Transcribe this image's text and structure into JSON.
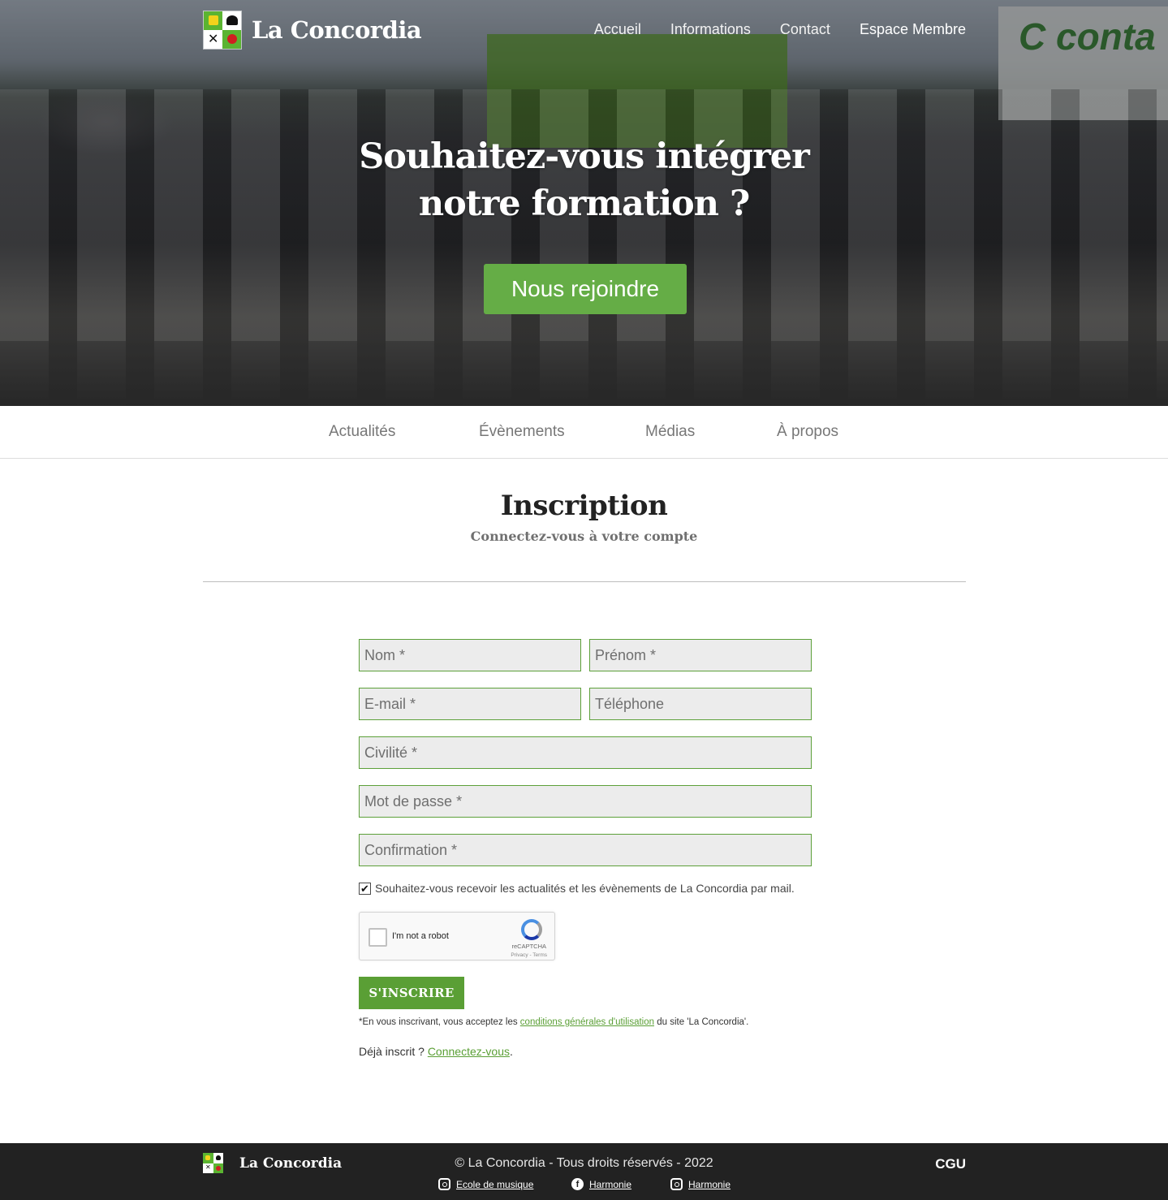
{
  "header": {
    "site_title": "La Concordia",
    "nav": [
      "Accueil",
      "Informations",
      "Contact",
      "Espace Membre"
    ]
  },
  "hero": {
    "title_line1": "Souhaitez-vous intégrer",
    "title_line2": "notre formation ?",
    "cta": "Nous rejoindre"
  },
  "subnav": [
    "Actualités",
    "Évènements",
    "Médias",
    "À propos"
  ],
  "page": {
    "title": "Inscription",
    "subtitle": "Connectez-vous à votre compte"
  },
  "form": {
    "nom_placeholder": "Nom *",
    "prenom_placeholder": "Prénom *",
    "email_placeholder": "E-mail *",
    "telephone_placeholder": "Téléphone",
    "civilite_placeholder": "Civilité *",
    "password_placeholder": "Mot de passe *",
    "confirmation_placeholder": "Confirmation *",
    "newsletter_checked": true,
    "newsletter_label": "Souhaitez-vous recevoir les actualités et les évènements de La Concordia par mail.",
    "recaptcha_label": "I'm not a robot",
    "recaptcha_brand": "reCAPTCHA",
    "recaptcha_terms": "Privacy - Terms",
    "submit_label": "S'INSCRIRE",
    "terms_prefix": "*En vous inscrivant, vous acceptez les ",
    "terms_link": "conditions générales d'utilisation",
    "terms_suffix": " du site 'La Concordia'.",
    "login_prefix": "Déjà inscrit ? ",
    "login_link": "Connectez-vous",
    "login_suffix": "."
  },
  "footer": {
    "title": "La Concordia",
    "copyright": "© La Concordia - Tous droits réservés - 2022",
    "cgu": "CGU",
    "social": [
      {
        "icon": "instagram-icon",
        "label": "Ecole de musique"
      },
      {
        "icon": "facebook-icon",
        "label": "Harmonie"
      },
      {
        "icon": "instagram-icon",
        "label": "Harmonie"
      }
    ]
  },
  "colors": {
    "accent": "#65ad46",
    "button": "#5a9f35",
    "footer_bg": "#222222"
  }
}
